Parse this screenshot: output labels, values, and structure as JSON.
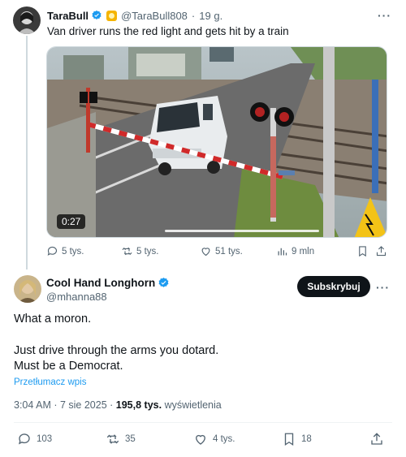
{
  "parent_tweet": {
    "author_name": "TaraBull",
    "handle": "@TaraBull808",
    "time_ago": "19 g.",
    "separator": "·",
    "text": "Van driver runs the red light and gets hit by a train",
    "video": {
      "duration": "0:27"
    },
    "actions": {
      "replies": "5 tys.",
      "reposts": "5 tys.",
      "likes": "51 tys.",
      "views": "9 mln"
    }
  },
  "main_tweet": {
    "author_name": "Cool Hand Longhorn",
    "handle": "@mhanna88",
    "subscribe_label": "Subskrybuj",
    "lines": [
      "What a moron.",
      "Just drive through the arms you dotard.",
      "Must be a Democrat."
    ],
    "translate_label": "Przetłumacz wpis",
    "timestamp": "3:04 AM · 7 sie 2025 ·",
    "views_count": "195,8 tys.",
    "views_label": "wyświetlenia",
    "actions": {
      "replies": "103",
      "reposts": "35",
      "likes": "4 tys.",
      "bookmarks": "18"
    }
  },
  "colors": {
    "text": "#0f1419",
    "secondary": "#536471",
    "link": "#1d9bf0",
    "verified": "#1d9bf0",
    "button_bg": "#0f1419"
  }
}
